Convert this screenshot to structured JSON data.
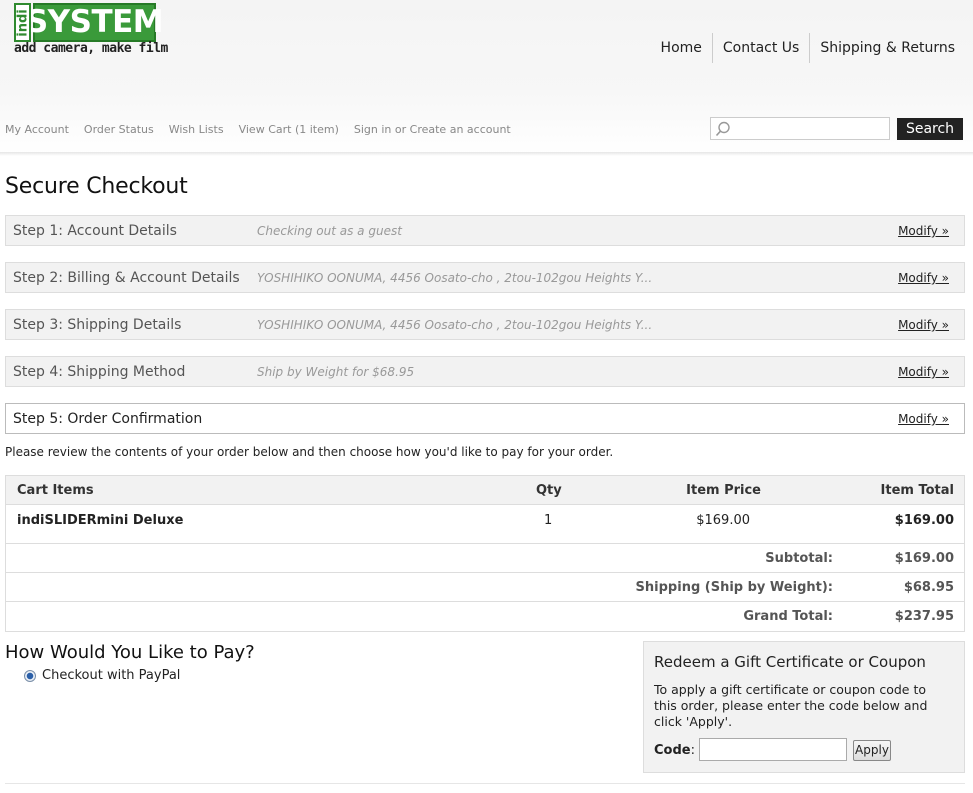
{
  "logo": {
    "indi": "indi",
    "system": "SYSTEM",
    "tagline": "add camera, make film"
  },
  "topnav": [
    "Home",
    "Contact Us",
    "Shipping & Returns"
  ],
  "account_links": [
    "My Account",
    "Order Status",
    "Wish Lists",
    "View Cart (1 item)",
    "Sign in or Create an account"
  ],
  "search": {
    "placeholder": "",
    "button": "Search"
  },
  "page_title": "Secure Checkout",
  "steps": [
    {
      "title": "Step 1: Account Details",
      "summary": "Checking out as a guest",
      "modify": "Modify »"
    },
    {
      "title": "Step 2: Billing & Account Details",
      "summary": "YOSHIHIKO OONUMA, 4456 Oosato-cho , 2tou-102gou Heights Y...",
      "modify": "Modify »"
    },
    {
      "title": "Step 3: Shipping Details",
      "summary": "YOSHIHIKO OONUMA, 4456 Oosato-cho , 2tou-102gou Heights Y...",
      "modify": "Modify »"
    },
    {
      "title": "Step 4: Shipping Method",
      "summary": "Ship by Weight for $68.95",
      "modify": "Modify »"
    },
    {
      "title": "Step 5: Order Confirmation",
      "summary": "",
      "modify": "Modify »"
    }
  ],
  "review_text": "Please review the contents of your order below and then choose how you'd like to pay for your order.",
  "cart": {
    "headers": {
      "items": "Cart Items",
      "qty": "Qty",
      "price": "Item Price",
      "total": "Item Total"
    },
    "rows": [
      {
        "name": "indiSLIDERmini Deluxe",
        "qty": "1",
        "price": "$169.00",
        "total": "$169.00"
      }
    ],
    "subtotal_label": "Subtotal:",
    "subtotal": "$169.00",
    "shipping_label": "Shipping (Ship by Weight):",
    "shipping": "$68.95",
    "grand_total_label": "Grand Total:",
    "grand_total": "$237.95"
  },
  "pay": {
    "title": "How Would You Like to Pay?",
    "option": "Checkout with PayPal"
  },
  "coupon": {
    "title": "Redeem a Gift Certificate or Coupon",
    "text": "To apply a gift certificate or coupon code to this order, please enter the code below and click 'Apply'.",
    "code_label": "Code",
    "code_colon": ":",
    "code_value": "",
    "apply": "Apply"
  },
  "colors": {
    "brand_green": "#3a9a3a",
    "search_button": "#222222",
    "step_bg": "#f2f2f2"
  }
}
